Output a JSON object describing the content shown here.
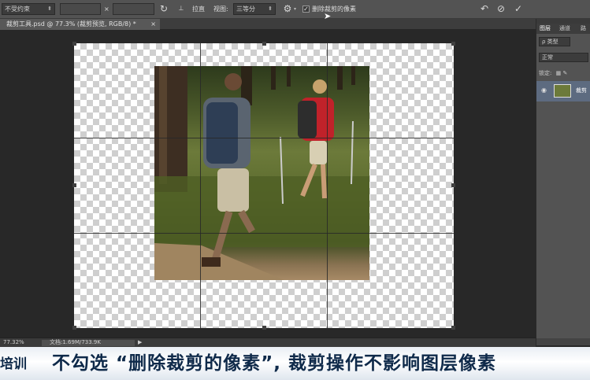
{
  "options_bar": {
    "ratio_select": "不受约束",
    "times_sign": "×",
    "straighten_label": "拉直",
    "view_label": "视图:",
    "view_select": "三等分",
    "delete_cropped_checked": true,
    "delete_cropped_label": "删除裁剪的像素",
    "icons": [
      "reset-rotate-icon",
      "swap-icon",
      "straighten-icon",
      "gear-icon",
      "undo-icon",
      "cancel-icon",
      "commit-icon"
    ]
  },
  "document_tab": {
    "title": "裁剪工具.psd @ 77.3% (裁剪预览, RGB/8) *",
    "close": "×"
  },
  "layers_panel": {
    "tabs": [
      "图层",
      "通道",
      "路"
    ],
    "kind_filter": "ρ 类型",
    "blend_mode": "正常",
    "lock_label": "锁定:",
    "layer_name": "裁剪"
  },
  "status_bar": {
    "zoom": "77.32%",
    "doc_size": "文档:1.69M/733.9K",
    "arrow": "▶"
  },
  "caption": {
    "logo_fragment": "培训",
    "text": "不勾选 “删除裁剪的像素”, 裁剪操作不影响图层像素"
  },
  "colors": {
    "options_bar_bg": "#535353",
    "canvas_bg": "#282828",
    "caption_text": "#0f2a4a",
    "selected_layer": "#5d6b80"
  }
}
